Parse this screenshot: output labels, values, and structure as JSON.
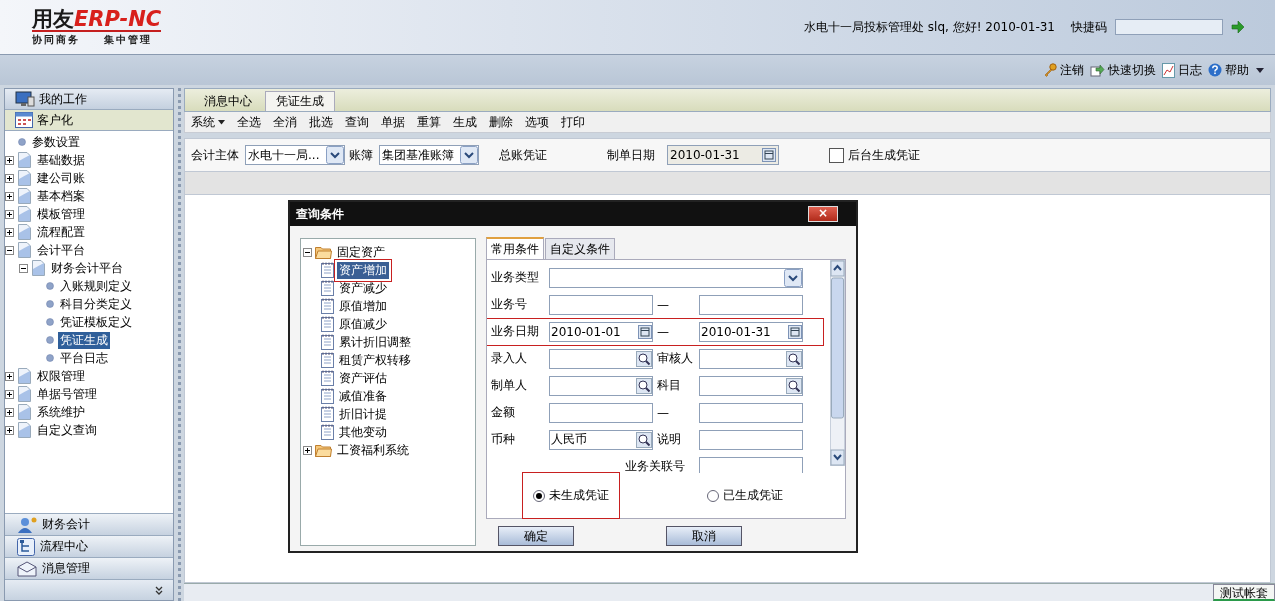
{
  "header": {
    "logo": {
      "brand": "用友",
      "mark": "ERP-NC",
      "tagline_left": "协同商务",
      "tagline_right": "集中管理"
    },
    "greeting": "水电十一局投标管理处 slq, 您好! 2010-01-31",
    "quick_code": {
      "label": "快捷码"
    },
    "links": [
      {
        "kind": "key",
        "label": "注销"
      },
      {
        "kind": "switch",
        "label": "快速切换"
      },
      {
        "kind": "log",
        "label": "日志"
      },
      {
        "kind": "help",
        "label": "帮助"
      }
    ]
  },
  "sidebar": {
    "sections": [
      {
        "kind": "monitor",
        "label": "我的工作",
        "selected": false
      },
      {
        "kind": "grid",
        "label": "客户化",
        "selected": true
      }
    ],
    "tree": [
      {
        "kind": "leaf",
        "label": "参数设置",
        "selected": false
      },
      {
        "kind": "node",
        "label": "基础数据",
        "expanded": false,
        "selected": false
      },
      {
        "kind": "node",
        "label": "建公司账",
        "expanded": false,
        "selected": false
      },
      {
        "kind": "node",
        "label": "基本档案",
        "expanded": false,
        "selected": false
      },
      {
        "kind": "node",
        "label": "模板管理",
        "expanded": false,
        "selected": false
      },
      {
        "kind": "node",
        "label": "流程配置",
        "expanded": false,
        "selected": false
      },
      {
        "kind": "node",
        "label": "会计平台",
        "expanded": true,
        "selected": false,
        "children": [
          {
            "kind": "node",
            "label": "财务会计平台",
            "expanded": true,
            "selected": false,
            "children": [
              {
                "kind": "leaf",
                "label": "入账规则定义",
                "selected": false
              },
              {
                "kind": "leaf",
                "label": "科目分类定义",
                "selected": false
              },
              {
                "kind": "leaf",
                "label": "凭证模板定义",
                "selected": false
              },
              {
                "kind": "leaf",
                "label": "凭证生成",
                "selected": true
              },
              {
                "kind": "leaf",
                "label": "平台日志",
                "selected": false
              }
            ]
          }
        ]
      },
      {
        "kind": "node",
        "label": "权限管理",
        "expanded": false,
        "selected": false
      },
      {
        "kind": "node",
        "label": "单据号管理",
        "expanded": false,
        "selected": false
      },
      {
        "kind": "node",
        "label": "系统维护",
        "expanded": false,
        "selected": false
      },
      {
        "kind": "node",
        "label": "自定义查询",
        "expanded": false,
        "selected": false
      }
    ],
    "modules": [
      {
        "kind": "person",
        "label": "财务会计"
      },
      {
        "kind": "flow",
        "label": "流程中心"
      },
      {
        "kind": "mail",
        "label": "消息管理"
      }
    ]
  },
  "main": {
    "tabs": [
      {
        "label": "消息中心",
        "selected": false
      },
      {
        "label": "凭证生成",
        "selected": true
      }
    ],
    "toolbar": [
      {
        "label": "系统",
        "menu": true
      },
      {
        "label": "全选",
        "menu": false
      },
      {
        "label": "全消",
        "menu": false
      },
      {
        "label": "批选",
        "menu": false
      },
      {
        "label": "查询",
        "menu": false
      },
      {
        "label": "单据",
        "menu": false
      },
      {
        "label": "重算",
        "menu": false
      },
      {
        "label": "生成",
        "menu": false
      },
      {
        "label": "删除",
        "menu": false
      },
      {
        "label": "选项",
        "menu": false
      },
      {
        "label": "打印",
        "menu": false
      }
    ],
    "filters": [
      {
        "kind": "select",
        "label": "会计主体",
        "value": "水电十一局..."
      },
      {
        "kind": "select",
        "label": "账簿",
        "value": "集团基准账簿"
      },
      {
        "kind": "text",
        "label": "总账凭证"
      },
      {
        "kind": "date",
        "label": "制单日期",
        "value": "2010-01-31"
      },
      {
        "kind": "checkbox",
        "label": "后台生成凭证",
        "checked": false
      }
    ],
    "status_bar": {
      "account": "测试帐套"
    }
  },
  "dialog": {
    "title": "查询条件",
    "close": "×",
    "tree": [
      {
        "label": "固定资产",
        "expanded": true,
        "children": [
          {
            "label": "资产增加",
            "selected": true,
            "highlighted": true
          },
          {
            "label": "资产减少",
            "selected": false,
            "highlighted": false
          },
          {
            "label": "原值增加",
            "selected": false,
            "highlighted": false
          },
          {
            "label": "原值减少",
            "selected": false,
            "highlighted": false
          },
          {
            "label": "累计折旧调整",
            "selected": false,
            "highlighted": false
          },
          {
            "label": "租赁产权转移",
            "selected": false,
            "highlighted": false
          },
          {
            "label": "资产评估",
            "selected": false,
            "highlighted": false
          },
          {
            "label": "减值准备",
            "selected": false,
            "highlighted": false
          },
          {
            "label": "折旧计提",
            "selected": false,
            "highlighted": false
          },
          {
            "label": "其他变动",
            "selected": false,
            "highlighted": false
          }
        ]
      },
      {
        "label": "工资福利系统",
        "expanded": false
      }
    ],
    "tabs": [
      {
        "label": "常用条件",
        "selected": true
      },
      {
        "label": "自定义条件",
        "selected": false
      }
    ],
    "rows": [
      {
        "label": "业务类型",
        "input": {
          "kind": "select"
        },
        "highlighted": false
      },
      {
        "label": "业务号",
        "input": {
          "kind": "text"
        },
        "joiner": "—",
        "input2": {
          "kind": "text"
        },
        "highlighted": false
      },
      {
        "label": "业务日期",
        "input": {
          "kind": "date",
          "value": "2010-01-01"
        },
        "joiner": "—",
        "input2": {
          "kind": "date",
          "value": "2010-01-31"
        },
        "highlighted": true
      },
      {
        "label": "录入人",
        "input": {
          "kind": "lookup"
        },
        "label2": "审核人",
        "input2": {
          "kind": "lookup"
        },
        "highlighted": false
      },
      {
        "label": "制单人",
        "input": {
          "kind": "lookup"
        },
        "label2": "科目",
        "input2": {
          "kind": "lookup"
        },
        "highlighted": false
      },
      {
        "label": "金额",
        "input": {
          "kind": "text"
        },
        "joiner": "—",
        "input2": {
          "kind": "text"
        },
        "highlighted": false
      },
      {
        "label": "币种",
        "input": {
          "kind": "lookup",
          "value": "人民币"
        },
        "label2": "说明",
        "input2": {
          "kind": "text"
        },
        "highlighted": false
      },
      {
        "label2": "业务关联号",
        "input2": {
          "kind": "text"
        },
        "highlighted": false
      }
    ],
    "radios": [
      {
        "label": "未生成凭证",
        "selected": true,
        "highlighted": true
      },
      {
        "label": "已生成凭证",
        "selected": false,
        "highlighted": false
      }
    ],
    "buttons": [
      "确定",
      "取消"
    ]
  }
}
